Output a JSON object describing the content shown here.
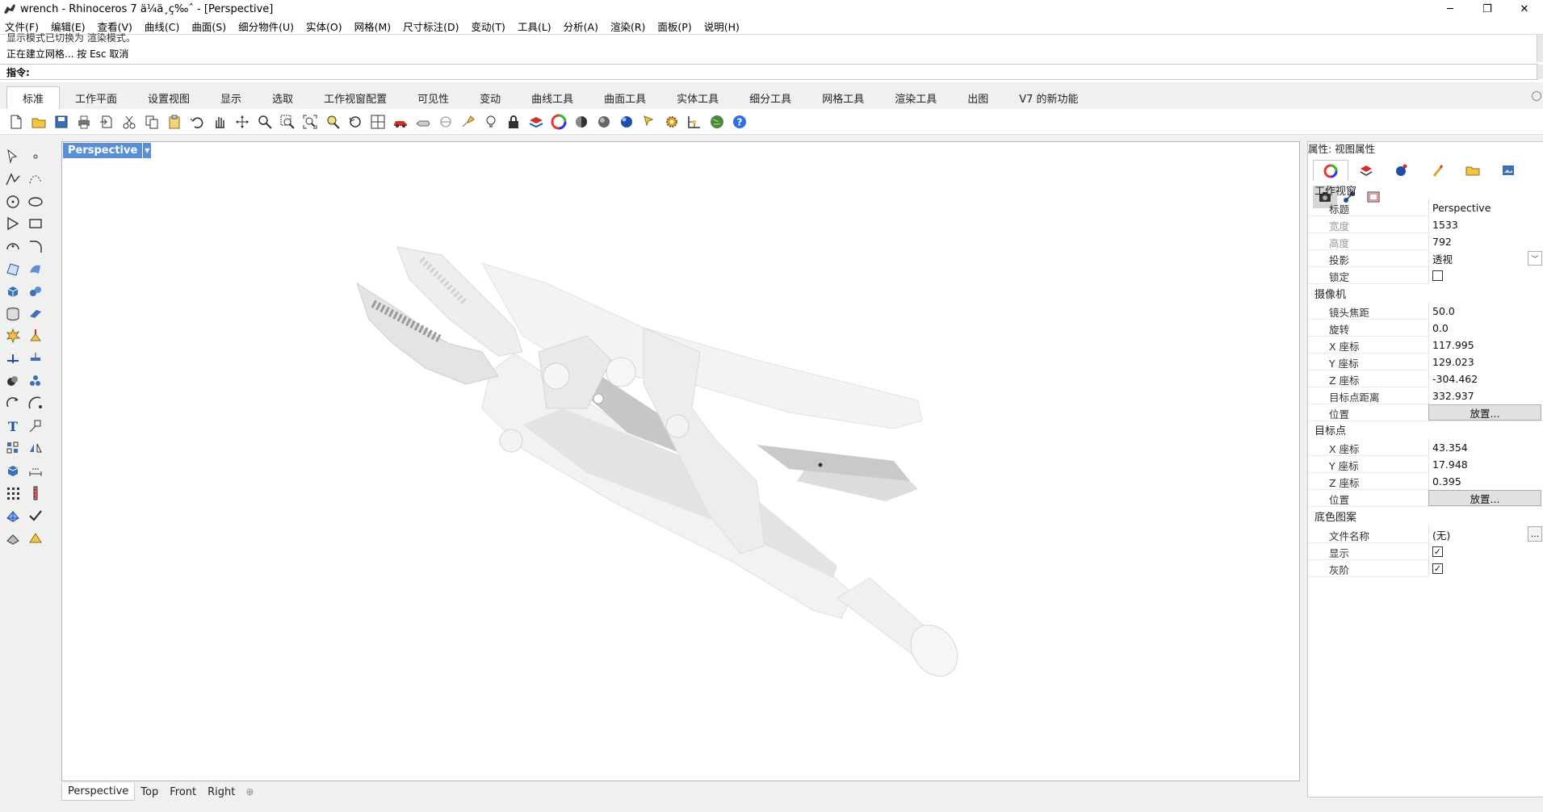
{
  "window": {
    "title": "wrench - Rhinoceros 7 ä¼ä¸ç‰ˆ - [Perspective]",
    "minimize": "─",
    "restore": "❐",
    "close": "✕"
  },
  "menu": [
    "文件(F)",
    "编辑(E)",
    "查看(V)",
    "曲线(C)",
    "曲面(S)",
    "细分物件(U)",
    "实体(O)",
    "网格(M)",
    "尺寸标注(D)",
    "变动(T)",
    "工具(L)",
    "分析(A)",
    "渲染(R)",
    "面板(P)",
    "说明(H)"
  ],
  "command": {
    "history_cut": "显示模式已切换为 渲染模式。",
    "history": "正在建立网格... 按 Esc 取消",
    "prompt": "指令:",
    "value": ""
  },
  "tabs": [
    "标准",
    "工作平面",
    "设置视图",
    "显示",
    "选取",
    "工作视窗配置",
    "可见性",
    "变动",
    "曲线工具",
    "曲面工具",
    "实体工具",
    "细分工具",
    "网格工具",
    "渲染工具",
    "出图",
    "V7 的新功能"
  ],
  "active_tab": "标准",
  "toolbar_icons": [
    "new-file-icon",
    "open-folder-icon",
    "save-icon",
    "print-icon",
    "import-icon",
    "cut-icon",
    "copy-icon",
    "paste-icon",
    "undo-icon",
    "pan-hand-icon",
    "rotate-view-icon",
    "zoom-dynamic-icon",
    "zoom-window-icon",
    "zoom-extents-icon",
    "zoom-selected-icon",
    "undo-view-icon",
    "four-viewports-icon",
    "car-icon",
    "camera-icon",
    "hide-icon",
    "show-icon",
    "light-bulb-icon",
    "lock-icon",
    "layer-icon",
    "color-wheel-icon",
    "material-sphere-icon",
    "shaded-sphere-icon",
    "render-sphere-icon",
    "select-filter-icon",
    "options-gear-icon",
    "grid-snap-icon",
    "globe-icon",
    "help-icon"
  ],
  "left_tools": [
    "select-arrow-icon",
    "point-icon",
    "polyline-icon",
    "curve-points-icon",
    "circle-icon",
    "ellipse-icon",
    "polygon-icon",
    "rectangle-icon",
    "arc-icon",
    "fillet-curve-icon",
    "surface-corner-icon",
    "sweep-icon",
    "box-icon",
    "spheres-icon",
    "cylinder-icon",
    "extrude-icon",
    "explode-icon",
    "trim-icon",
    "split-icon",
    "align-icon",
    "boolean-icon",
    "group-icon",
    "rotate-icon",
    "scale-icon",
    "text-icon",
    "move-icon",
    "array-icon",
    "mirror-icon",
    "block-icon",
    "dimension-icon",
    "grid-array-icon",
    "measure-icon",
    "mesh-icon",
    "check-icon",
    "section-icon",
    "render-icon"
  ],
  "viewport": {
    "name": "Perspective",
    "tabs": [
      "Perspective",
      "Top",
      "Front",
      "Right"
    ],
    "add_tab": "⊕"
  },
  "properties": {
    "title": "属性: 视图属性",
    "sections": {
      "viewport": "工作视窗",
      "camera": "摄像机",
      "target": "目标点",
      "wallpaper": "底色图案"
    },
    "viewport": {
      "title_label": "标题",
      "title_value": "Perspective",
      "width_label": "宽度",
      "width_value": "1533",
      "height_label": "高度",
      "height_value": "792",
      "projection_label": "投影",
      "projection_value": "透视",
      "lock_label": "锁定",
      "lock_checked": false
    },
    "camera": {
      "lens_label": "镜头焦距",
      "lens_value": "50.0",
      "rotation_label": "旋转",
      "rotation_value": "0.0",
      "x_label": "X 座标",
      "x_value": "117.995",
      "y_label": "Y 座标",
      "y_value": "129.023",
      "z_label": "Z 座标",
      "z_value": "-304.462",
      "distance_label": "目标点距离",
      "distance_value": "332.937",
      "place_label": "位置",
      "place_button": "放置..."
    },
    "target": {
      "x_label": "X 座标",
      "x_value": "43.354",
      "y_label": "Y 座标",
      "y_value": "17.948",
      "z_label": "Z 座标",
      "z_value": "0.395",
      "place_label": "位置",
      "place_button": "放置..."
    },
    "wallpaper": {
      "file_label": "文件名称",
      "file_value": "(无)",
      "browse": "...",
      "show_label": "显示",
      "show_checked": true,
      "gray_label": "灰阶",
      "gray_checked": true
    }
  },
  "colors": {
    "viewport_title_bg": "#5a8fd8",
    "model_fill": "#f4f4f4",
    "model_shadow": "#c8c8c8"
  }
}
